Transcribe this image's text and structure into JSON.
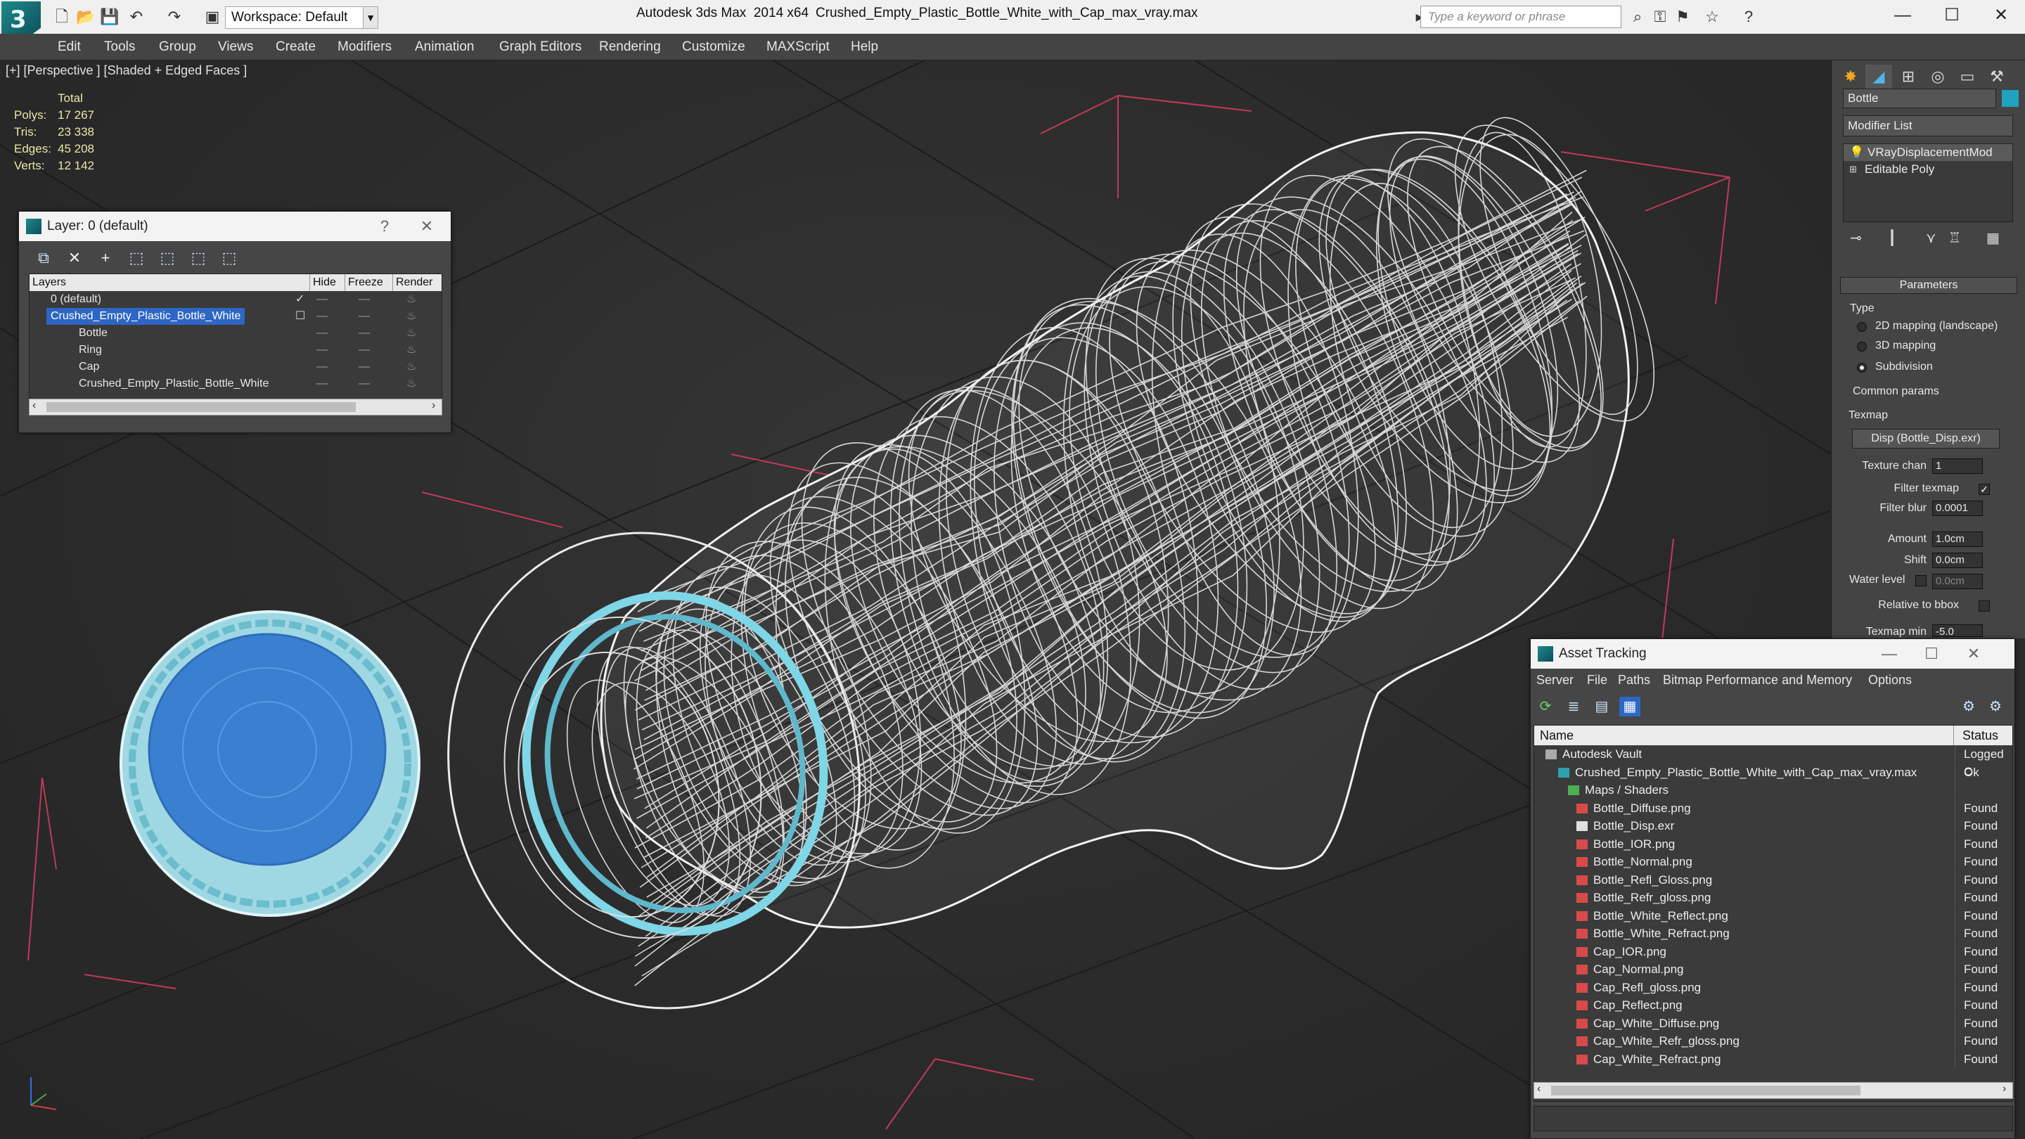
{
  "titlebar": {
    "workspace": "Workspace: Default",
    "app_title": "Autodesk 3ds Max  2014 x64",
    "doc_title": "Crushed_Empty_Plastic_Bottle_White_with_Cap_max_vray.max",
    "search_placeholder": "Type a keyword or phrase"
  },
  "menubar": {
    "items": [
      "Edit",
      "Tools",
      "Group",
      "Views",
      "Create",
      "Modifiers",
      "Animation",
      "Graph Editors",
      "Rendering",
      "Customize",
      "MAXScript",
      "Help"
    ]
  },
  "viewport": {
    "label": "[+] [Perspective ] [Shaded + Edged Faces ]",
    "stats": {
      "header": "Total",
      "rows": [
        {
          "key": "Polys:",
          "value": "17 267"
        },
        {
          "key": "Tris:",
          "value": "23 338"
        },
        {
          "key": "Edges:",
          "value": "45 208"
        },
        {
          "key": "Verts:",
          "value": "12 142"
        }
      ]
    }
  },
  "layer_window": {
    "title": "Layer: 0 (default)",
    "help": "?",
    "close": "✕",
    "columns": [
      "Layers",
      "Hide",
      "Freeze",
      "Render"
    ],
    "rows": [
      {
        "name": "0 (default)",
        "indent": 0
      },
      {
        "name": "Crushed_Empty_Plastic_Bottle_White",
        "indent": 0,
        "selected": true
      },
      {
        "name": "Bottle",
        "indent": 1
      },
      {
        "name": "Ring",
        "indent": 1
      },
      {
        "name": "Cap",
        "indent": 1
      },
      {
        "name": "Crushed_Empty_Plastic_Bottle_White",
        "indent": 1
      }
    ],
    "dash": "—",
    "check": "✓"
  },
  "asset_window": {
    "title": "Asset Tracking",
    "menu": [
      "Server",
      "File",
      "Paths",
      "Bitmap Performance and Memory",
      "Options"
    ],
    "columns": [
      "Name",
      "Status"
    ],
    "rows": [
      {
        "name": "Autodesk Vault",
        "status": "Logged C",
        "indent": 0,
        "icon": "vault"
      },
      {
        "name": "Crushed_Empty_Plastic_Bottle_White_with_Cap_max_vray.max",
        "status": "Ok",
        "indent": 1,
        "icon": "max"
      },
      {
        "name": "Maps / Shaders",
        "status": "",
        "indent": 2,
        "icon": "folder"
      },
      {
        "name": "Bottle_Diffuse.png",
        "status": "Found",
        "indent": 3,
        "icon": "png"
      },
      {
        "name": "Bottle_Disp.exr",
        "status": "Found",
        "indent": 3,
        "icon": "exr"
      },
      {
        "name": "Bottle_IOR.png",
        "status": "Found",
        "indent": 3,
        "icon": "png"
      },
      {
        "name": "Bottle_Normal.png",
        "status": "Found",
        "indent": 3,
        "icon": "png"
      },
      {
        "name": "Bottle_Refl_Gloss.png",
        "status": "Found",
        "indent": 3,
        "icon": "png"
      },
      {
        "name": "Bottle_Refr_gloss.png",
        "status": "Found",
        "indent": 3,
        "icon": "png"
      },
      {
        "name": "Bottle_White_Reflect.png",
        "status": "Found",
        "indent": 3,
        "icon": "png"
      },
      {
        "name": "Bottle_White_Refract.png",
        "status": "Found",
        "indent": 3,
        "icon": "png"
      },
      {
        "name": "Cap_IOR.png",
        "status": "Found",
        "indent": 3,
        "icon": "png"
      },
      {
        "name": "Cap_Normal.png",
        "status": "Found",
        "indent": 3,
        "icon": "png"
      },
      {
        "name": "Cap_Refl_gloss.png",
        "status": "Found",
        "indent": 3,
        "icon": "png"
      },
      {
        "name": "Cap_Reflect.png",
        "status": "Found",
        "indent": 3,
        "icon": "png"
      },
      {
        "name": "Cap_White_Diffuse.png",
        "status": "Found",
        "indent": 3,
        "icon": "png"
      },
      {
        "name": "Cap_White_Refr_gloss.png",
        "status": "Found",
        "indent": 3,
        "icon": "png"
      },
      {
        "name": "Cap_White_Refract.png",
        "status": "Found",
        "indent": 3,
        "icon": "png"
      }
    ]
  },
  "command_panel": {
    "object_name": "Bottle",
    "object_color": "#1fa3c0",
    "modifier_list": "Modifier List",
    "stack": [
      "VRayDisplacementMod",
      "Editable Poly"
    ],
    "parameters_title": "Parameters",
    "type_label": "Type",
    "type_options": [
      "2D mapping (landscape)",
      "3D mapping",
      "Subdivision"
    ],
    "type_selected": "Subdivision",
    "common_params": "Common params",
    "texmap_label": "Texmap",
    "texmap_value": "Disp (Bottle_Disp.exr)",
    "texture_chan_label": "Texture chan",
    "texture_chan": "1",
    "filter_texmap_label": "Filter texmap",
    "filter_blur_label": "Filter blur",
    "filter_blur": "0.0001",
    "amount_label": "Amount",
    "amount": "1.0cm",
    "shift_label": "Shift",
    "shift": "0.0cm",
    "water_level_label": "Water level",
    "water_level": "0.0cm",
    "relative_bbox_label": "Relative to bbox",
    "texmap_min_label": "Texmap min",
    "texmap_min": "-5.0"
  },
  "colors": {
    "accent": "#2d66c4",
    "wire": "#ffffff",
    "cap_blue": "#3a7fd0",
    "cap_cyan": "#7fd6e6",
    "grid_red": "#c0395a"
  }
}
